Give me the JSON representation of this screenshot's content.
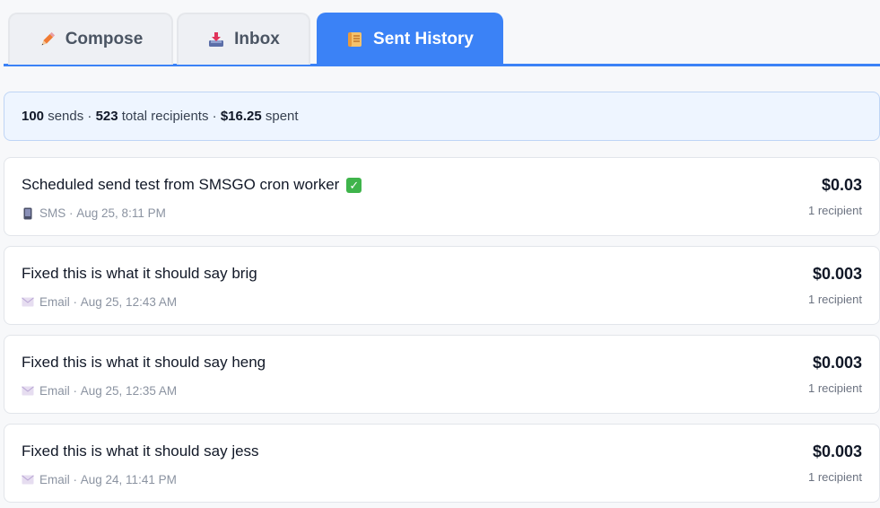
{
  "tabs": [
    {
      "label": "Compose",
      "icon": "pencil-icon",
      "active": false
    },
    {
      "label": "Inbox",
      "icon": "inbox-tray-icon",
      "active": false
    },
    {
      "label": "Sent History",
      "icon": "scroll-icon",
      "active": true
    }
  ],
  "summary": {
    "sends_count": "100",
    "sends_label": " sends · ",
    "recipients_count": "523",
    "recipients_label": " total recipients · ",
    "spent_amount": "$16.25",
    "spent_label": " spent"
  },
  "history": [
    {
      "title": "Scheduled send test from SMSGO cron worker",
      "title_emoji": "check-mark-icon",
      "channel": "SMS",
      "channel_icon": "phone-icon",
      "date": "Aug 25, 8:11 PM",
      "cost": "$0.03",
      "recipients": "1 recipient"
    },
    {
      "title": "Fixed this is what it should say brig",
      "channel": "Email",
      "channel_icon": "envelope-icon",
      "date": "Aug 25, 12:43 AM",
      "cost": "$0.003",
      "recipients": "1 recipient"
    },
    {
      "title": "Fixed this is what it should say heng",
      "channel": "Email",
      "channel_icon": "envelope-icon",
      "date": "Aug 25, 12:35 AM",
      "cost": "$0.003",
      "recipients": "1 recipient"
    },
    {
      "title": "Fixed this is what it should say jess",
      "channel": "Email",
      "channel_icon": "envelope-icon",
      "date": "Aug 24, 11:41 PM",
      "cost": "$0.003",
      "recipients": "1 recipient"
    }
  ],
  "meta_separator": " · ",
  "colors": {
    "accent": "#3b82f6",
    "summary_bg": "#eef5ff",
    "check": "#3fb44b"
  }
}
